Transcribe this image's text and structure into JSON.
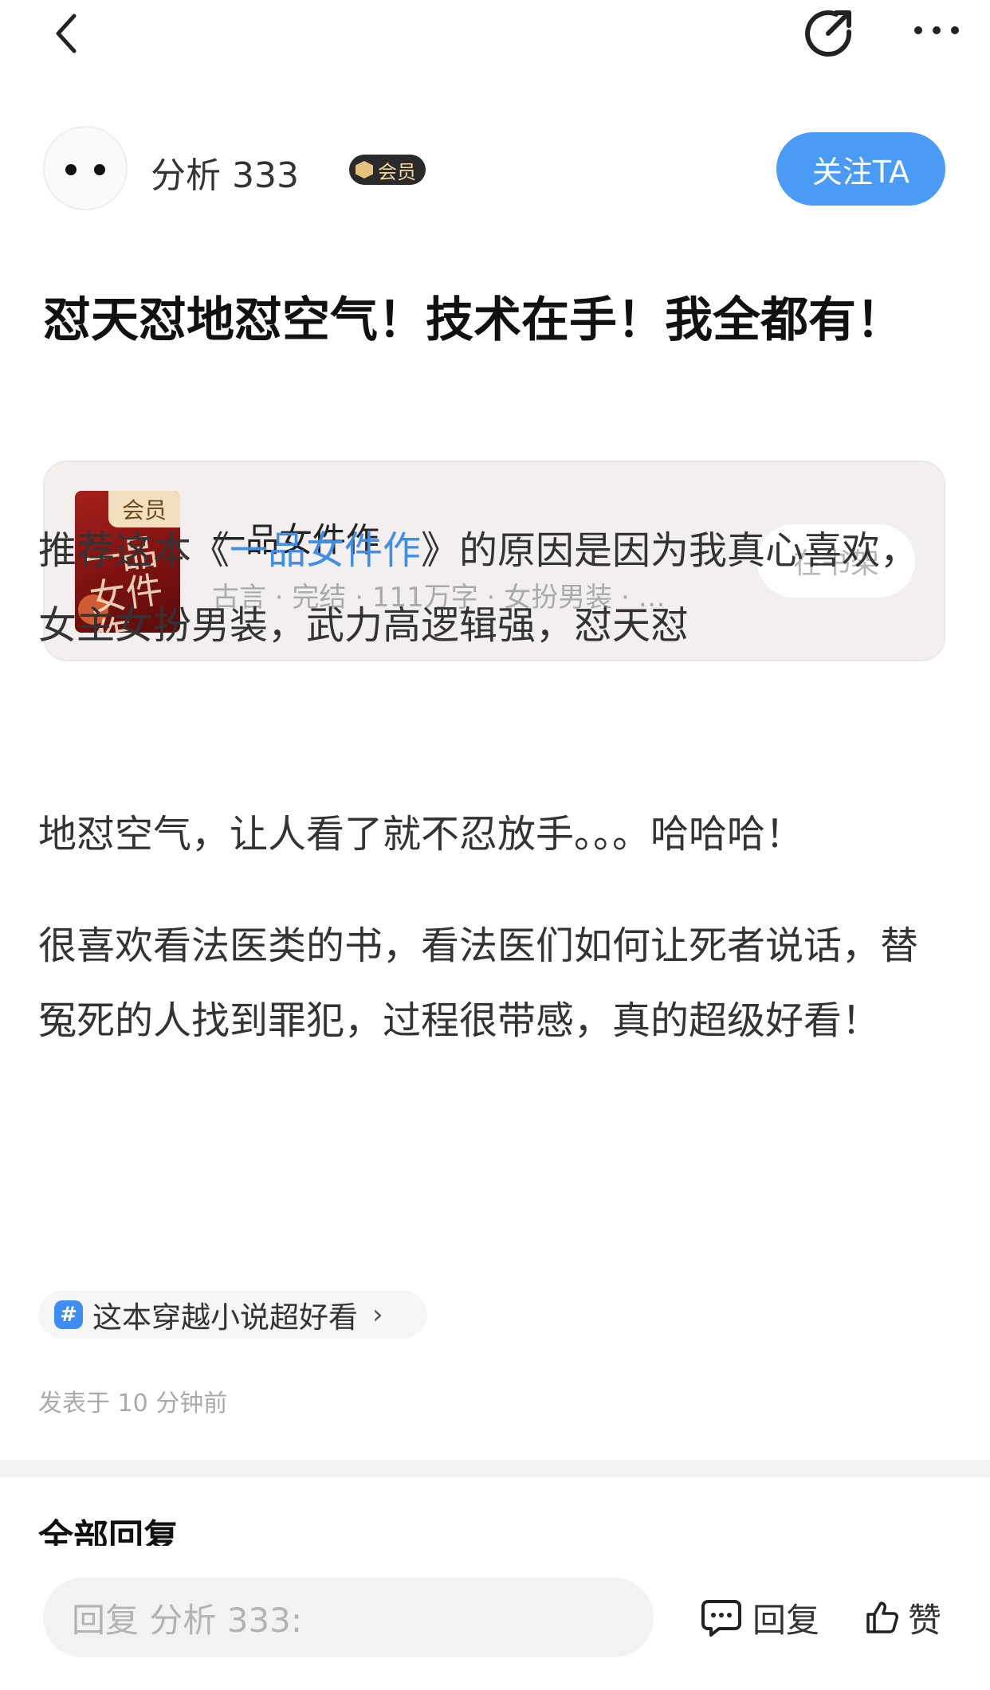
{
  "topbar": {
    "back_icon": "chevron-left-icon",
    "share_icon": "share-icon",
    "more_icon": "more-dots-icon"
  },
  "author": {
    "name": "分析 333",
    "badge": "会员",
    "follow_label": "关注TA"
  },
  "post": {
    "title": "怼天怼地怼空气！技术在手！我全都有！",
    "book": {
      "cover_tag": "会员",
      "cover_art": "一品女件作",
      "name": "一品女件作",
      "meta": "古言 · 完结 · 111万字 · 女扮男装 · …",
      "shelf_label": "在书架"
    },
    "paragraph1_prefix": "推荐这本《",
    "paragraph1_link": "一品女件作",
    "paragraph1_suffix": "》的原因是因为我真心喜欢，女主女扮男装，武力高逻辑强，怼天怼",
    "paragraph2": "地怼空气，让人看了就不忍放手。。。哈哈哈！",
    "paragraph3": "很喜欢看法医类的书，看法医们如何让死者说话，替冤死的人找到罪犯，过程很带感，真的超级好看！",
    "topic": {
      "icon": "#",
      "label": "这本穿越小说超好看",
      "chevron": "›"
    },
    "time": "发表于 10 分钟前"
  },
  "replies": {
    "heading": "全部回复"
  },
  "bottom": {
    "input_placeholder": "回复 分析 333:",
    "reply_label": "回复",
    "like_label": "赞"
  },
  "colors": {
    "accent": "#4a9bf5",
    "link": "#3f8ee8",
    "badge_bg": "#2a2a2a",
    "badge_text": "#f1d59a"
  }
}
